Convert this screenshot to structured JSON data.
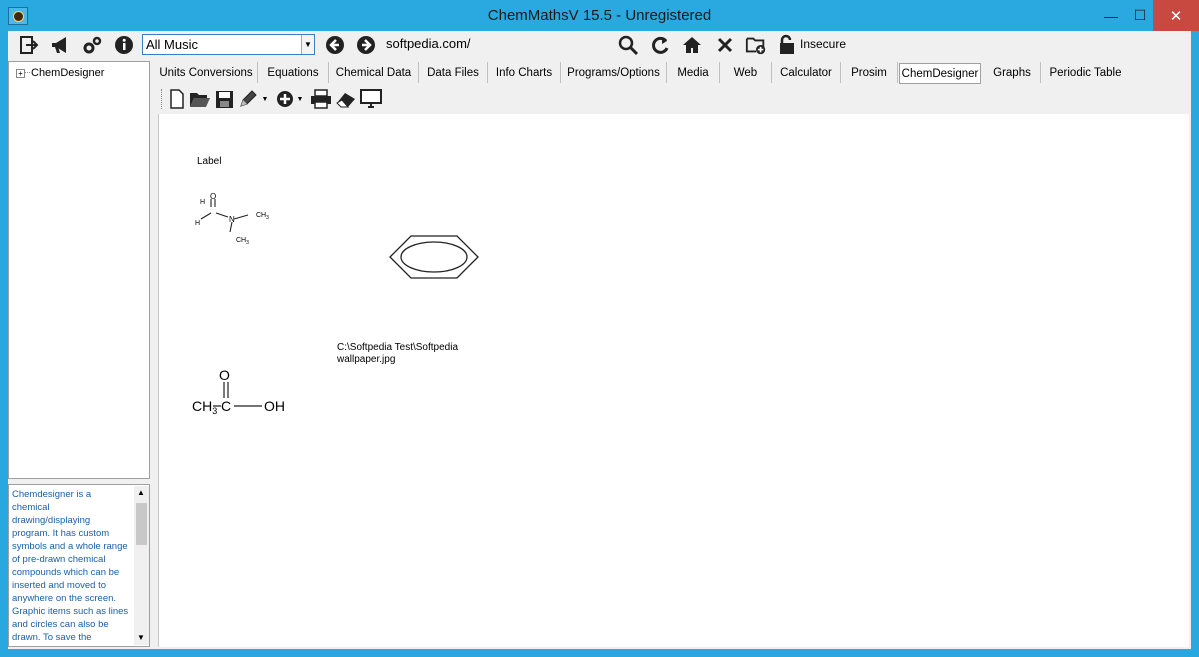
{
  "window": {
    "title": "ChemMathsV 15.5 - Unregistered",
    "minimize": "—",
    "maximize": "☐",
    "close": "✕"
  },
  "toolbar": {
    "music_select": "All Music",
    "url": "softpedia.com/",
    "security": "Insecure"
  },
  "tree": {
    "expander": "+",
    "root": "ChemDesigner"
  },
  "description": "Chemdesigner is a chemical drawing/displaying program. It has custom symbols and a whole range of pre-drawn chemical compounds which can be inserted and moved to anywhere on the screen. Graphic items such as lines and circles can also be drawn. To save the",
  "tabs": [
    "Units Conversions",
    "Equations",
    "Chemical Data",
    "Data Files",
    "Info Charts",
    "Programs/Options",
    "Media",
    "Web",
    "Calculator",
    "Prosim",
    "ChemDesigner",
    "Graphs",
    "Periodic Table"
  ],
  "active_tab": "ChemDesigner",
  "canvas": {
    "label": "Label",
    "file_path_line1": "C:\\Softpedia Test\\Softpedia",
    "file_path_line2": "wallpaper.jpg",
    "acetic": {
      "left": "CH",
      "sub": "3",
      "mid": "C",
      "right": "OH",
      "top": "O"
    },
    "dmf": {
      "h_left": "H",
      "h_top": "H",
      "o": "O",
      "n": "N",
      "ch3_right": "CH",
      "ch3_right_sub": "3",
      "ch3_bottom": "CH",
      "ch3_bottom_sub": "3"
    }
  },
  "colors": {
    "titlebar": "#2aa9e1",
    "close": "#c7493f",
    "desc_text": "#1a5fa8"
  }
}
